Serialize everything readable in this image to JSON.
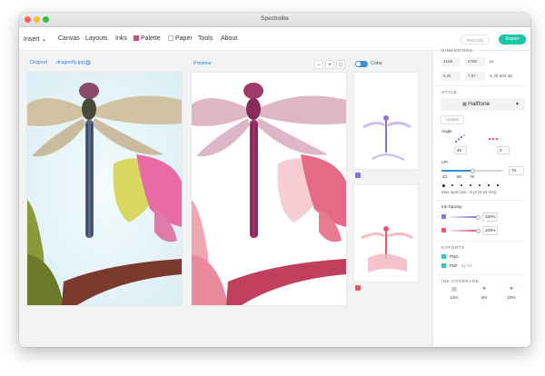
{
  "window": {
    "title": "Spectrolite"
  },
  "menu": [
    {
      "label": "Insert"
    },
    {
      "label": "Canvas"
    },
    {
      "label": "Layouts"
    },
    {
      "label": "Inks"
    },
    {
      "label": "Palette",
      "swatch": "#c0508c"
    },
    {
      "label": "Paper"
    },
    {
      "label": "Tools"
    },
    {
      "label": "About"
    }
  ],
  "toolbar": {
    "secondary_label": "RISO.tify",
    "export_label": "Export"
  },
  "workspace": {
    "original_tab": "Original",
    "file_name": "dragonfly.jpg",
    "preview_tab": "Preview",
    "color_label": "Color",
    "zoom_out_icon": "zoom-out-icon",
    "zoom_in_icon": "zoom-in-icon",
    "fit_icon": "fit-screen-icon",
    "layer_colors": [
      "#8e6fd6",
      "#e8566c"
    ]
  },
  "sidebar": {
    "dimensions": {
      "header": "DIMENSIONS",
      "width_px": "3166",
      "height_px": "4765",
      "px_unit": "px",
      "width_in": "5.31",
      "height_in": "7.97",
      "in_unit": "in @ 600 dpi"
    },
    "style": {
      "header": "STYLE",
      "mode": "Halftone",
      "update_label": "Update"
    },
    "angle": {
      "label": "Angle",
      "left_value": "45",
      "right_value": "0",
      "left_color": "#8e6fd6",
      "right_color": "#e8566c"
    },
    "lpi": {
      "label": "LPI",
      "value": "76",
      "fraction": 0.5,
      "ticks": [
        "43",
        "60",
        "76"
      ],
      "max_spot": "Max spot size: .8 pt (0.34 mm)"
    },
    "ink_opacity": {
      "label": "Ink Opacity",
      "inks": [
        {
          "color": "#8e6fd6",
          "value": "100%",
          "fraction": 1.0
        },
        {
          "color": "#e8566c",
          "value": "100%",
          "fraction": 1.0
        }
      ]
    },
    "exports": {
      "header": "EXPORTS",
      "png_label": "PNG",
      "pdf_label": "PDF",
      "pdf_note": "by ink"
    },
    "ink_coverage": {
      "header": "INK COVERAGE",
      "items": [
        {
          "icon": "document-icon",
          "value": "14%",
          "color": "#888888"
        },
        {
          "icon": "ink-drop-icon",
          "value": "4%",
          "color": "#8e6fd6"
        },
        {
          "icon": "ink-drop-icon",
          "value": "10%",
          "color": "#e8566c"
        }
      ]
    }
  }
}
